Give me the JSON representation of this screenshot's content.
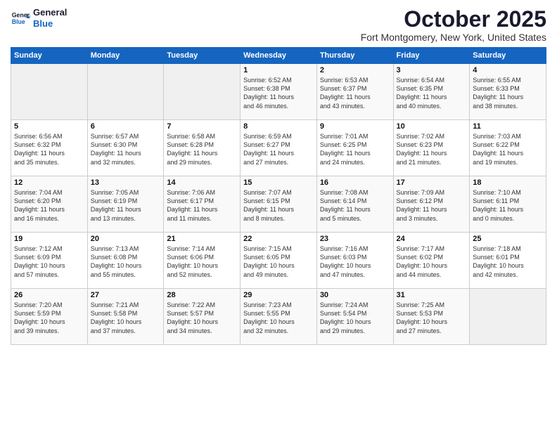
{
  "logo": {
    "line1": "General",
    "line2": "Blue"
  },
  "title": "October 2025",
  "subtitle": "Fort Montgomery, New York, United States",
  "days_header": [
    "Sunday",
    "Monday",
    "Tuesday",
    "Wednesday",
    "Thursday",
    "Friday",
    "Saturday"
  ],
  "weeks": [
    [
      {
        "day": "",
        "info": ""
      },
      {
        "day": "",
        "info": ""
      },
      {
        "day": "",
        "info": ""
      },
      {
        "day": "1",
        "info": "Sunrise: 6:52 AM\nSunset: 6:38 PM\nDaylight: 11 hours\nand 46 minutes."
      },
      {
        "day": "2",
        "info": "Sunrise: 6:53 AM\nSunset: 6:37 PM\nDaylight: 11 hours\nand 43 minutes."
      },
      {
        "day": "3",
        "info": "Sunrise: 6:54 AM\nSunset: 6:35 PM\nDaylight: 11 hours\nand 40 minutes."
      },
      {
        "day": "4",
        "info": "Sunrise: 6:55 AM\nSunset: 6:33 PM\nDaylight: 11 hours\nand 38 minutes."
      }
    ],
    [
      {
        "day": "5",
        "info": "Sunrise: 6:56 AM\nSunset: 6:32 PM\nDaylight: 11 hours\nand 35 minutes."
      },
      {
        "day": "6",
        "info": "Sunrise: 6:57 AM\nSunset: 6:30 PM\nDaylight: 11 hours\nand 32 minutes."
      },
      {
        "day": "7",
        "info": "Sunrise: 6:58 AM\nSunset: 6:28 PM\nDaylight: 11 hours\nand 29 minutes."
      },
      {
        "day": "8",
        "info": "Sunrise: 6:59 AM\nSunset: 6:27 PM\nDaylight: 11 hours\nand 27 minutes."
      },
      {
        "day": "9",
        "info": "Sunrise: 7:01 AM\nSunset: 6:25 PM\nDaylight: 11 hours\nand 24 minutes."
      },
      {
        "day": "10",
        "info": "Sunrise: 7:02 AM\nSunset: 6:23 PM\nDaylight: 11 hours\nand 21 minutes."
      },
      {
        "day": "11",
        "info": "Sunrise: 7:03 AM\nSunset: 6:22 PM\nDaylight: 11 hours\nand 19 minutes."
      }
    ],
    [
      {
        "day": "12",
        "info": "Sunrise: 7:04 AM\nSunset: 6:20 PM\nDaylight: 11 hours\nand 16 minutes."
      },
      {
        "day": "13",
        "info": "Sunrise: 7:05 AM\nSunset: 6:19 PM\nDaylight: 11 hours\nand 13 minutes."
      },
      {
        "day": "14",
        "info": "Sunrise: 7:06 AM\nSunset: 6:17 PM\nDaylight: 11 hours\nand 11 minutes."
      },
      {
        "day": "15",
        "info": "Sunrise: 7:07 AM\nSunset: 6:15 PM\nDaylight: 11 hours\nand 8 minutes."
      },
      {
        "day": "16",
        "info": "Sunrise: 7:08 AM\nSunset: 6:14 PM\nDaylight: 11 hours\nand 5 minutes."
      },
      {
        "day": "17",
        "info": "Sunrise: 7:09 AM\nSunset: 6:12 PM\nDaylight: 11 hours\nand 3 minutes."
      },
      {
        "day": "18",
        "info": "Sunrise: 7:10 AM\nSunset: 6:11 PM\nDaylight: 11 hours\nand 0 minutes."
      }
    ],
    [
      {
        "day": "19",
        "info": "Sunrise: 7:12 AM\nSunset: 6:09 PM\nDaylight: 10 hours\nand 57 minutes."
      },
      {
        "day": "20",
        "info": "Sunrise: 7:13 AM\nSunset: 6:08 PM\nDaylight: 10 hours\nand 55 minutes."
      },
      {
        "day": "21",
        "info": "Sunrise: 7:14 AM\nSunset: 6:06 PM\nDaylight: 10 hours\nand 52 minutes."
      },
      {
        "day": "22",
        "info": "Sunrise: 7:15 AM\nSunset: 6:05 PM\nDaylight: 10 hours\nand 49 minutes."
      },
      {
        "day": "23",
        "info": "Sunrise: 7:16 AM\nSunset: 6:03 PM\nDaylight: 10 hours\nand 47 minutes."
      },
      {
        "day": "24",
        "info": "Sunrise: 7:17 AM\nSunset: 6:02 PM\nDaylight: 10 hours\nand 44 minutes."
      },
      {
        "day": "25",
        "info": "Sunrise: 7:18 AM\nSunset: 6:01 PM\nDaylight: 10 hours\nand 42 minutes."
      }
    ],
    [
      {
        "day": "26",
        "info": "Sunrise: 7:20 AM\nSunset: 5:59 PM\nDaylight: 10 hours\nand 39 minutes."
      },
      {
        "day": "27",
        "info": "Sunrise: 7:21 AM\nSunset: 5:58 PM\nDaylight: 10 hours\nand 37 minutes."
      },
      {
        "day": "28",
        "info": "Sunrise: 7:22 AM\nSunset: 5:57 PM\nDaylight: 10 hours\nand 34 minutes."
      },
      {
        "day": "29",
        "info": "Sunrise: 7:23 AM\nSunset: 5:55 PM\nDaylight: 10 hours\nand 32 minutes."
      },
      {
        "day": "30",
        "info": "Sunrise: 7:24 AM\nSunset: 5:54 PM\nDaylight: 10 hours\nand 29 minutes."
      },
      {
        "day": "31",
        "info": "Sunrise: 7:25 AM\nSunset: 5:53 PM\nDaylight: 10 hours\nand 27 minutes."
      },
      {
        "day": "",
        "info": ""
      }
    ]
  ]
}
